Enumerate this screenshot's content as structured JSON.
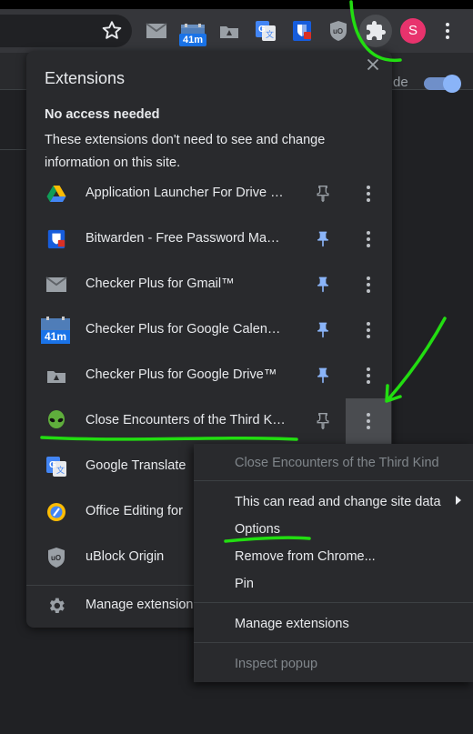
{
  "toolbar": {
    "calendar_badge": "41m",
    "avatar_letter": "S",
    "page_text_fragment": "de"
  },
  "popup": {
    "title": "Extensions",
    "section_heading": "No access needed",
    "section_description": "These extensions don't need to see and change information on this site.",
    "extensions": [
      {
        "name": "Application Launcher For Drive (by Google)",
        "pinned": false
      },
      {
        "name": "Bitwarden - Free Password Manager",
        "pinned": true
      },
      {
        "name": "Checker Plus for Gmail™",
        "pinned": true
      },
      {
        "name": "Checker Plus for Google Calendar™",
        "pinned": true,
        "badge": "41m"
      },
      {
        "name": "Checker Plus for Google Drive™",
        "pinned": true
      },
      {
        "name": "Close Encounters of the Third Kind",
        "pinned": false
      },
      {
        "name": "Google Translate",
        "pinned": false
      },
      {
        "name": "Office Editing for Docs, Sheets & Slides",
        "pinned": false
      },
      {
        "name": "uBlock Origin",
        "pinned": false
      }
    ],
    "manage_label": "Manage extensions"
  },
  "context_menu": {
    "header": "Close Encounters of the Third Kind",
    "site_access": "This can read and change site data",
    "options": "Options",
    "remove": "Remove from Chrome...",
    "pin": "Pin",
    "manage": "Manage extensions",
    "inspect": "Inspect popup"
  },
  "colors": {
    "annotation": "#22dd11",
    "pin_active": "#8ab4f8",
    "pin_inactive": "#9aa0a6",
    "avatar": "#e8336d"
  }
}
